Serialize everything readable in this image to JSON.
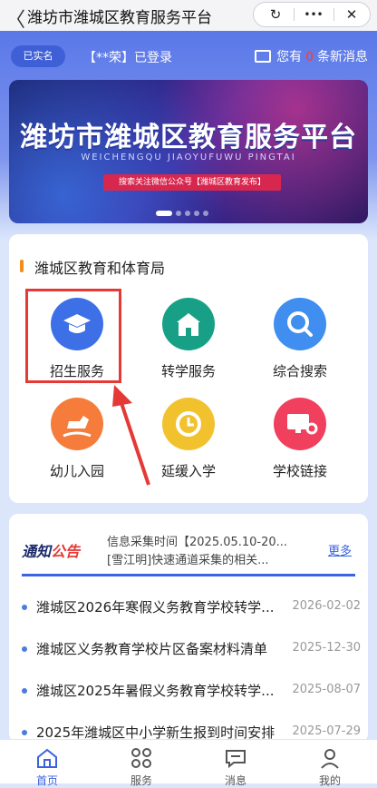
{
  "window": {
    "title": "潍坊市潍城区教育服务平台",
    "back_glyph": "〈",
    "refresh_glyph": "↻",
    "more_glyph": "•••",
    "close_glyph": "✕"
  },
  "user": {
    "verified_label": "已实名",
    "login_text": "【**荣】已登录",
    "message_prefix": "您有",
    "message_count": "0",
    "message_suffix": "条新消息"
  },
  "banner": {
    "title": "潍坊市潍城区教育服务平台",
    "subtitle": "WEICHENGQU JIAOYUFUWU PINGTAI",
    "pill": "搜索关注微信公众号【潍城区教育发布】",
    "slide_count": 5,
    "active_slide": 0
  },
  "section": {
    "title": "潍城区教育和体育局",
    "services": [
      {
        "label": "招生服务",
        "icon": "graduation-cap-icon",
        "color": "#3d6fe6"
      },
      {
        "label": "转学服务",
        "icon": "school-building-icon",
        "color": "#17a085"
      },
      {
        "label": "综合搜索",
        "icon": "search-icon",
        "color": "#3f8ef0"
      },
      {
        "label": "幼儿入园",
        "icon": "rocking-horse-icon",
        "color": "#f57c3b"
      },
      {
        "label": "延缓入学",
        "icon": "clock-icon",
        "color": "#f2c12e"
      },
      {
        "label": "学校链接",
        "icon": "computer-link-icon",
        "color": "#f0405e"
      }
    ]
  },
  "notice": {
    "logo_a": "通知",
    "logo_b": "公告",
    "ticker": [
      "信息采集时间【2025.05.10-20...",
      "[雪江明]快速通道采集的相关..."
    ],
    "more": "更多",
    "items": [
      {
        "text": "潍城区2026年寒假义务教育学校转学...",
        "date": "2026-02-02"
      },
      {
        "text": "潍城区义务教育学校片区备案材料清单",
        "date": "2025-12-30"
      },
      {
        "text": "潍城区2025年暑假义务教育学校转学...",
        "date": "2025-08-07"
      },
      {
        "text": "2025年潍城区中小学新生报到时间安排",
        "date": "2025-07-29"
      }
    ]
  },
  "tabbar": [
    {
      "label": "首页",
      "icon": "home-icon",
      "active": true
    },
    {
      "label": "服务",
      "icon": "grid-icon",
      "active": false
    },
    {
      "label": "消息",
      "icon": "chat-icon",
      "active": false
    },
    {
      "label": "我的",
      "icon": "user-icon",
      "active": false
    }
  ],
  "colors": {
    "accent": "#3a63e0",
    "highlight": "#e53935",
    "badge": "#ff3b30"
  }
}
